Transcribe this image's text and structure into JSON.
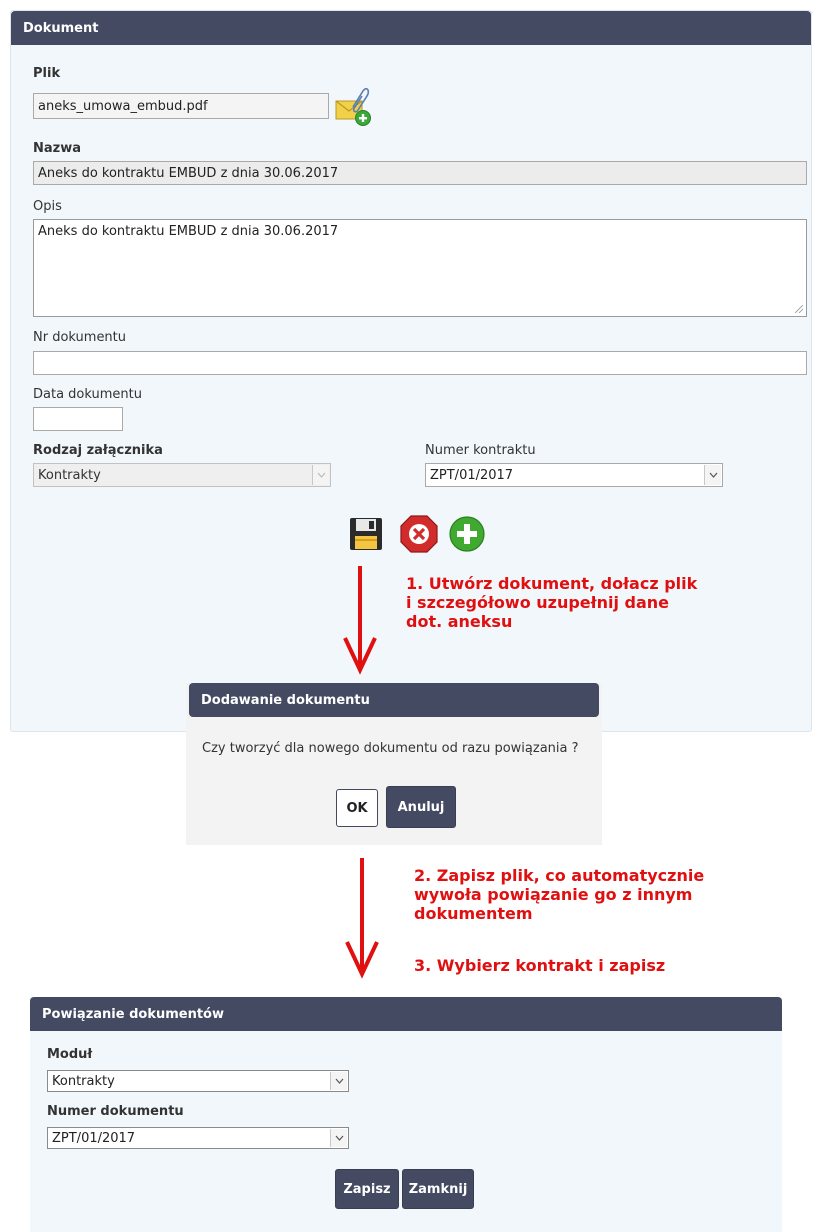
{
  "document_panel": {
    "header": "Dokument",
    "file_label": "Plik",
    "file_value": "aneks_umowa_embud.pdf",
    "name_label": "Nazwa",
    "name_value": "Aneks do kontraktu EMBUD z dnia 30.06.2017",
    "description_label": "Opis",
    "description_value": "Aneks do kontraktu EMBUD z dnia 30.06.2017",
    "doc_number_label": "Nr dokumentu",
    "doc_number_value": "",
    "doc_date_label": "Data dokumentu",
    "doc_date_value": "",
    "attachment_type_label": "Rodzaj załącznika",
    "attachment_type_value": "Kontrakty",
    "contract_number_label": "Numer kontraktu",
    "contract_number_value": "ZPT/01/2017",
    "icons": [
      "attach-file-icon",
      "save-icon",
      "delete-icon",
      "add-icon"
    ]
  },
  "annotations": {
    "step1": [
      "1. Utwórz dokument, dołacz plik",
      "i szczegółowo uzupełnij dane",
      "dot. aneksu"
    ],
    "step2": [
      "2. Zapisz plik, co automatycznie",
      "wywoła powiązanie go z innym",
      "dokumentem"
    ],
    "step3": "3. Wybierz kontrakt i zapisz",
    "arrow_color": "#e01010"
  },
  "dialog": {
    "title": "Dodawanie dokumentu",
    "message": "Czy tworzyć dla nowego dokumentu od razu powiązania ?",
    "ok_label": "OK",
    "cancel_label": "Anuluj"
  },
  "link_panel": {
    "header": "Powiązanie dokumentów",
    "module_label": "Moduł",
    "module_value": "Kontrakty",
    "doc_number_label": "Numer dokumentu",
    "doc_number_value": "ZPT/01/2017",
    "save_label": "Zapisz",
    "close_label": "Zamknij"
  },
  "colors": {
    "header_bg": "#454a63",
    "panel_bg": "#f2f7fb",
    "accent_red": "#e01010"
  }
}
